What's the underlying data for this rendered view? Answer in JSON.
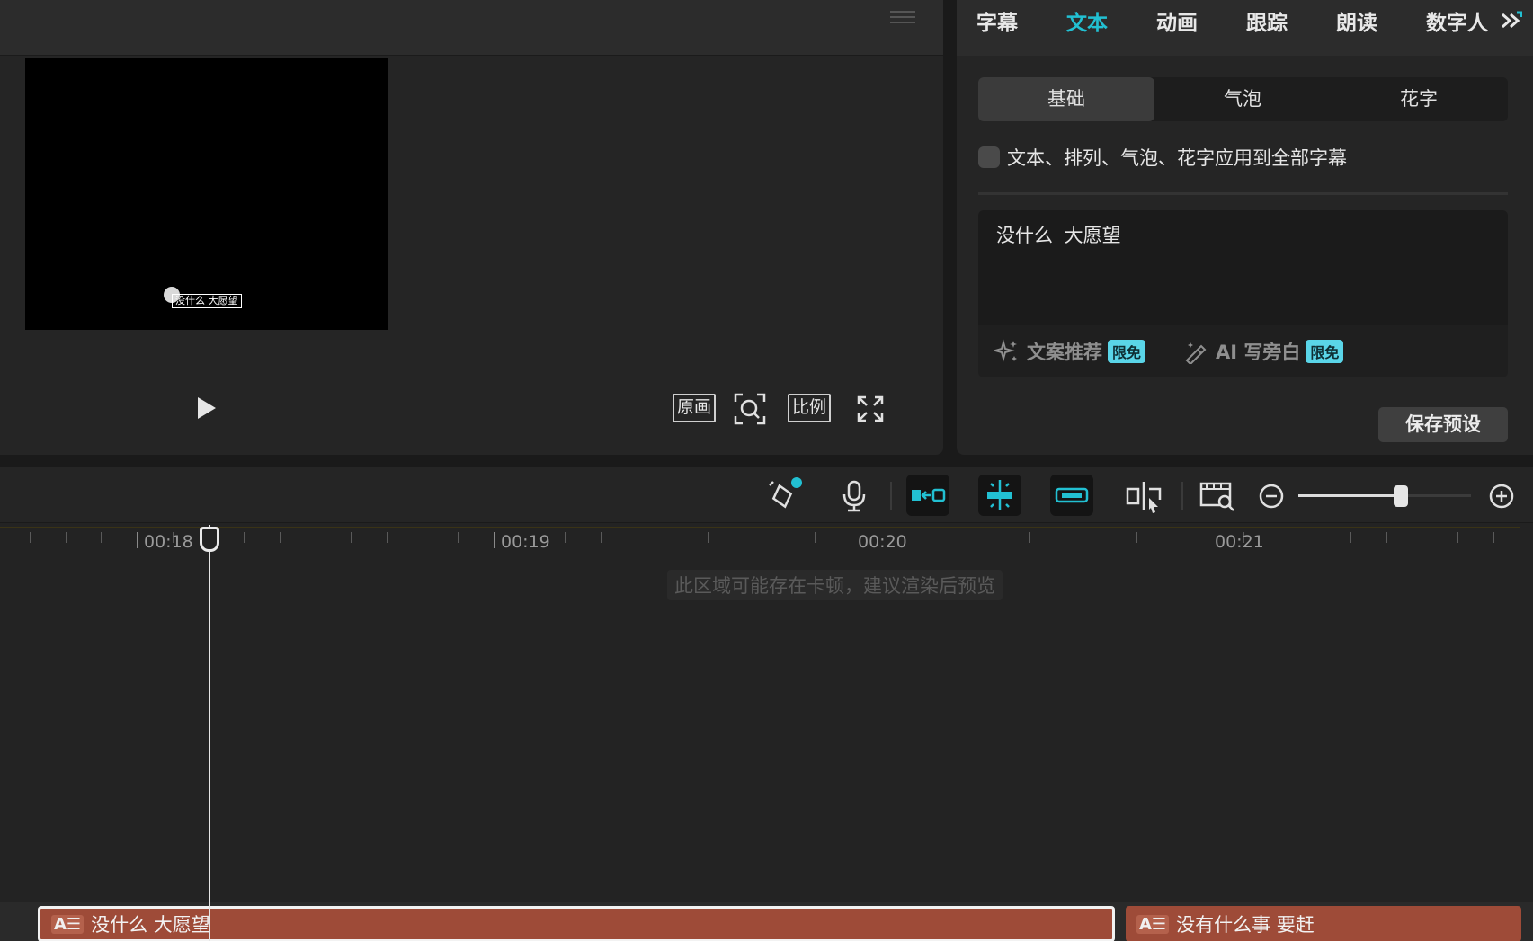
{
  "preview": {
    "menu_icon": "hamburger-icon",
    "overlay_subtitle": "没什么 大愿望",
    "buttons": {
      "original": "原画",
      "ratio": "比例"
    }
  },
  "right_panel": {
    "tabs": [
      {
        "label": "字幕",
        "active": false
      },
      {
        "label": "文本",
        "active": true
      },
      {
        "label": "动画",
        "active": false
      },
      {
        "label": "跟踪",
        "active": false
      },
      {
        "label": "朗读",
        "active": false
      },
      {
        "label": "数字人",
        "active": false
      }
    ],
    "segments": [
      {
        "label": "基础",
        "active": true
      },
      {
        "label": "气泡",
        "active": false
      },
      {
        "label": "花字",
        "active": false
      }
    ],
    "apply_all_label": "文本、排列、气泡、花字应用到全部字幕",
    "apply_all_checked": false,
    "text_value": "没什么 大愿望",
    "ai_actions": [
      {
        "label": "文案推荐",
        "badge": "限免",
        "icon": "sparkle-icon"
      },
      {
        "label": "AI 写旁白",
        "badge": "限免",
        "icon": "magic-wand-icon"
      }
    ],
    "save_preset": "保存预设"
  },
  "timeline": {
    "time_labels": [
      "00:18",
      "00:19",
      "00:20",
      "00:21"
    ],
    "warning": "此区域可能存在卡顿，建议渲染后预览",
    "zoom_level": 0.6,
    "clips": [
      {
        "icon_text": "A☰",
        "label": "没什么 大愿望",
        "selected": true
      },
      {
        "icon_text": "A☰",
        "label": "没有什么事 要赶",
        "selected": false
      }
    ]
  },
  "colors": {
    "accent": "#22c0d2",
    "clip": "#9e4b38",
    "badge": "#5ad5e8"
  }
}
